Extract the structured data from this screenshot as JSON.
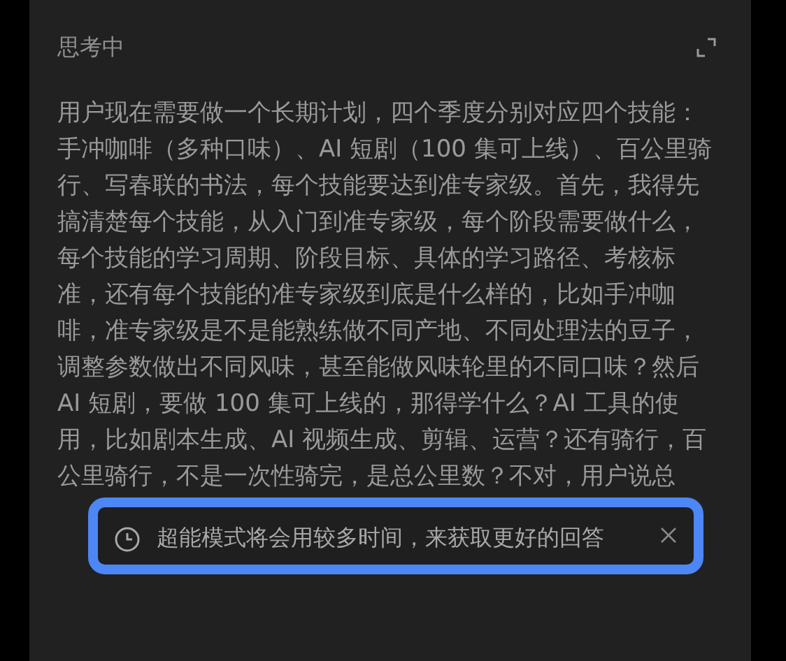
{
  "panel": {
    "title": "思考中",
    "text": "用户现在需要做一个长期计划，四个季度分别对应四个技能：手冲咖啡（多种口味）、AI 短剧（100 集可上线）、百公里骑行、写春联的书法，每个技能要达到准专家级。首先，我得先搞清楚每个技能，从入门到准专家级，每个阶段需要做什么，每个技能的学习周期、阶段目标、具体的学习路径、考核标准，还有每个技能的准专家级到底是什么样的，比如手冲咖啡，准专家级是不是能熟练做不同产地、不同处理法的豆子，调整参数做出不同风味，甚至能做风味轮里的不同口味？然后 AI 短剧，要做 100 集可上线的，那得学什么？AI 工具的使用，比如剧本生成、AI 视频生成、剪辑、运营？还有骑行，百公里骑行，不是一次性骑完，是总公里数？不对，用户说总"
  },
  "toast": {
    "message": "超能模式将会用较多时间，来获取更好的回答"
  }
}
